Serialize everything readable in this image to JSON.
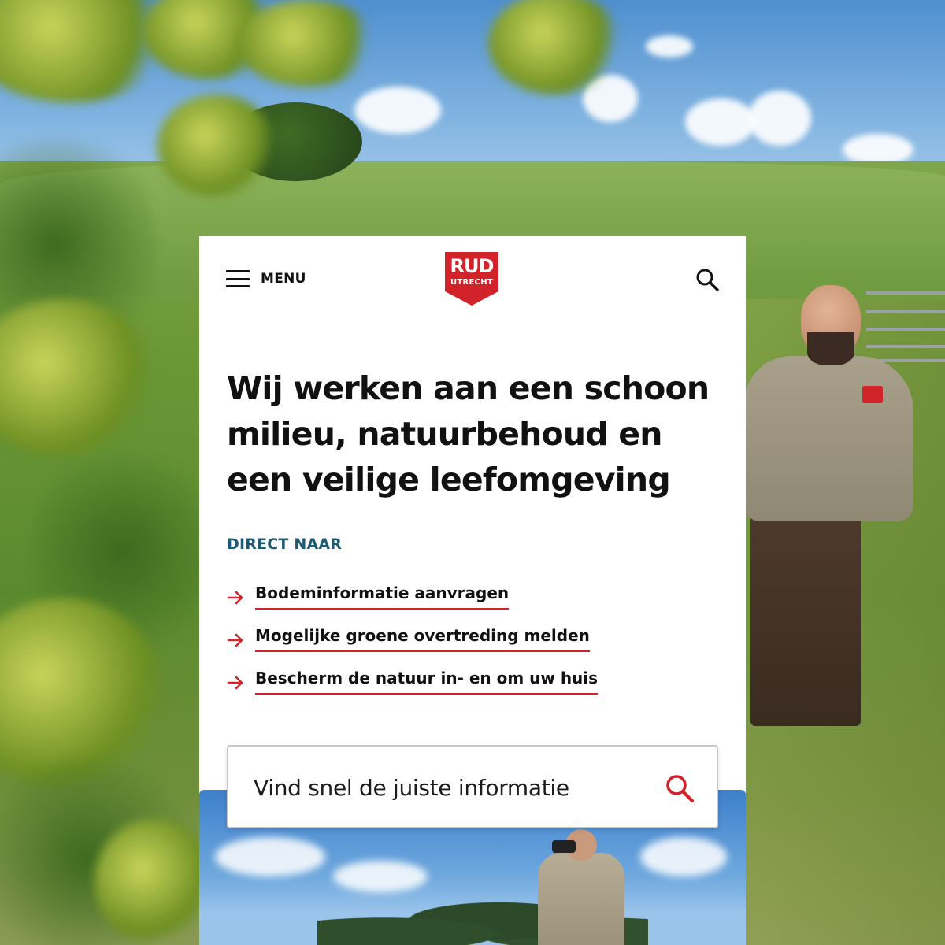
{
  "header": {
    "menu_label": "MENU",
    "logo": {
      "line1": "RUD",
      "line2": "UTRECHT",
      "color": "#d2232a"
    },
    "search_icon": "search-icon"
  },
  "hero": {
    "headline": "Wij werken aan een schoon milieu, natuurbehoud en een veilige leefomgeving"
  },
  "direct": {
    "label": "DIRECT NAAR",
    "links": [
      {
        "label": "Bodeminformatie aanvragen"
      },
      {
        "label": "Mogelijke groene overtreding melden"
      },
      {
        "label": "Bescherm de natuur in- en om uw huis"
      }
    ]
  },
  "search": {
    "placeholder": "Vind snel de juiste informatie"
  },
  "colors": {
    "accent": "#d2232a",
    "label": "#1d5a73",
    "text": "#111111"
  }
}
